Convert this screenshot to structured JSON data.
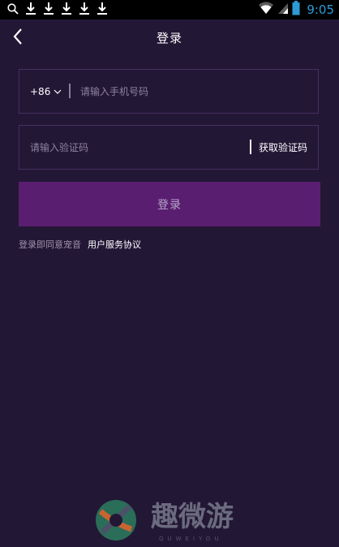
{
  "status_bar": {
    "time": "9:05",
    "left_icons": [
      "search-icon",
      "download-icon",
      "download-icon",
      "download-icon",
      "download-icon",
      "download-icon"
    ],
    "right_icons": [
      "wifi-icon",
      "signal-icon",
      "battery-icon"
    ]
  },
  "header": {
    "title": "登录",
    "back_icon": "chevron-left-icon"
  },
  "form": {
    "country_code": "+86",
    "phone_placeholder": "请输入手机号码",
    "code_placeholder": "请输入验证码",
    "get_code_label": "获取验证码",
    "login_label": "登录"
  },
  "agreement": {
    "prefix": "登录即同意宠音",
    "link": "用户服务协议"
  },
  "watermark": {
    "text": "趣微游",
    "subtext": "QUWEIYOU"
  },
  "colors": {
    "background": "#231736",
    "field_border": "#43305f",
    "login_button": "#5a1e70",
    "login_text": "#b7a7c9",
    "status_time": "#2d9bd8"
  }
}
